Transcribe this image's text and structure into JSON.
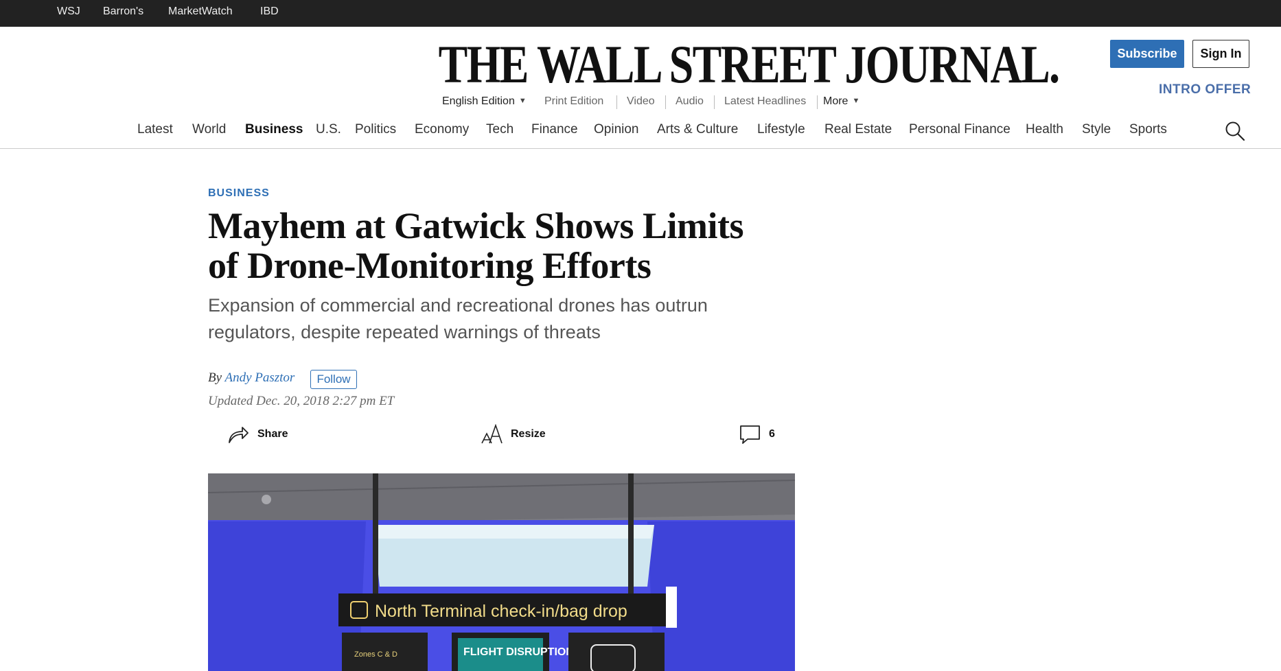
{
  "topbar": {
    "links": [
      "WSJ",
      "Barron's",
      "MarketWatch",
      "IBD"
    ]
  },
  "masthead": {
    "title": "THE WALL STREET JOURNAL."
  },
  "header": {
    "subscribe_label": "Subscribe",
    "signin_label": "Sign In",
    "intro_offer": "INTRO OFFER"
  },
  "edition": {
    "current": "English Edition",
    "links": [
      "Print Edition",
      "Video",
      "Audio",
      "Latest Headlines"
    ],
    "more": "More"
  },
  "nav": {
    "items": [
      "Latest",
      "World",
      "Business",
      "U.S.",
      "Politics",
      "Economy",
      "Tech",
      "Finance",
      "Opinion",
      "Arts & Culture",
      "Lifestyle",
      "Real Estate",
      "Personal Finance",
      "Health",
      "Style",
      "Sports"
    ],
    "active": "Business"
  },
  "article": {
    "section": "BUSINESS",
    "headline": "Mayhem at Gatwick Shows Limits of Drone-Monitoring Efforts",
    "dek": "Expansion of commercial and recreational drones has outrun regulators, despite repeated warnings of threats",
    "byline_prefix": "By",
    "author": "Andy Pasztor",
    "follow_label": "Follow",
    "updated": "Updated Dec. 20, 2018 2:27 pm ET",
    "share_label": "Share",
    "resize_label": "Resize",
    "comments_count": "6"
  },
  "photo": {
    "sign_main": "North Terminal check-in/bag drop",
    "sign_left": "Zones C & D",
    "sign_mid": "FLIGHT DISRUPTION"
  },
  "colors": {
    "accent": "#2e6fb5",
    "topbar": "#222222",
    "intro": "#4a6ea9"
  }
}
